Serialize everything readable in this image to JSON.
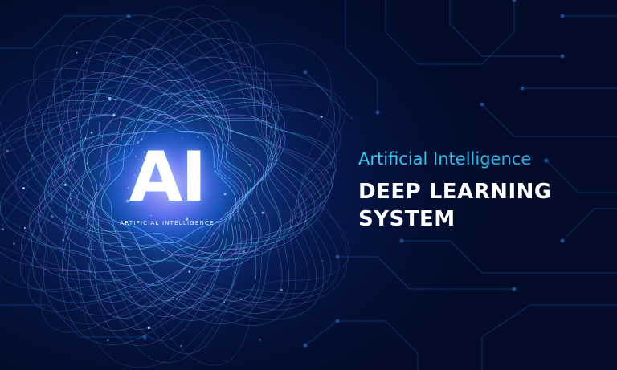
{
  "logo": {
    "mark": "AI",
    "caption": "ARTIFICIAL INTELLIGENCE"
  },
  "headline": {
    "subtitle": "Artificial Intelligence",
    "title_line1": "DEEP LEARNING",
    "title_line2": "SYSTEM"
  },
  "colors": {
    "background": "#020c2b",
    "subtitle": "#2bc7ee",
    "title": "#ffffff",
    "glow": "#4fa3ff"
  }
}
